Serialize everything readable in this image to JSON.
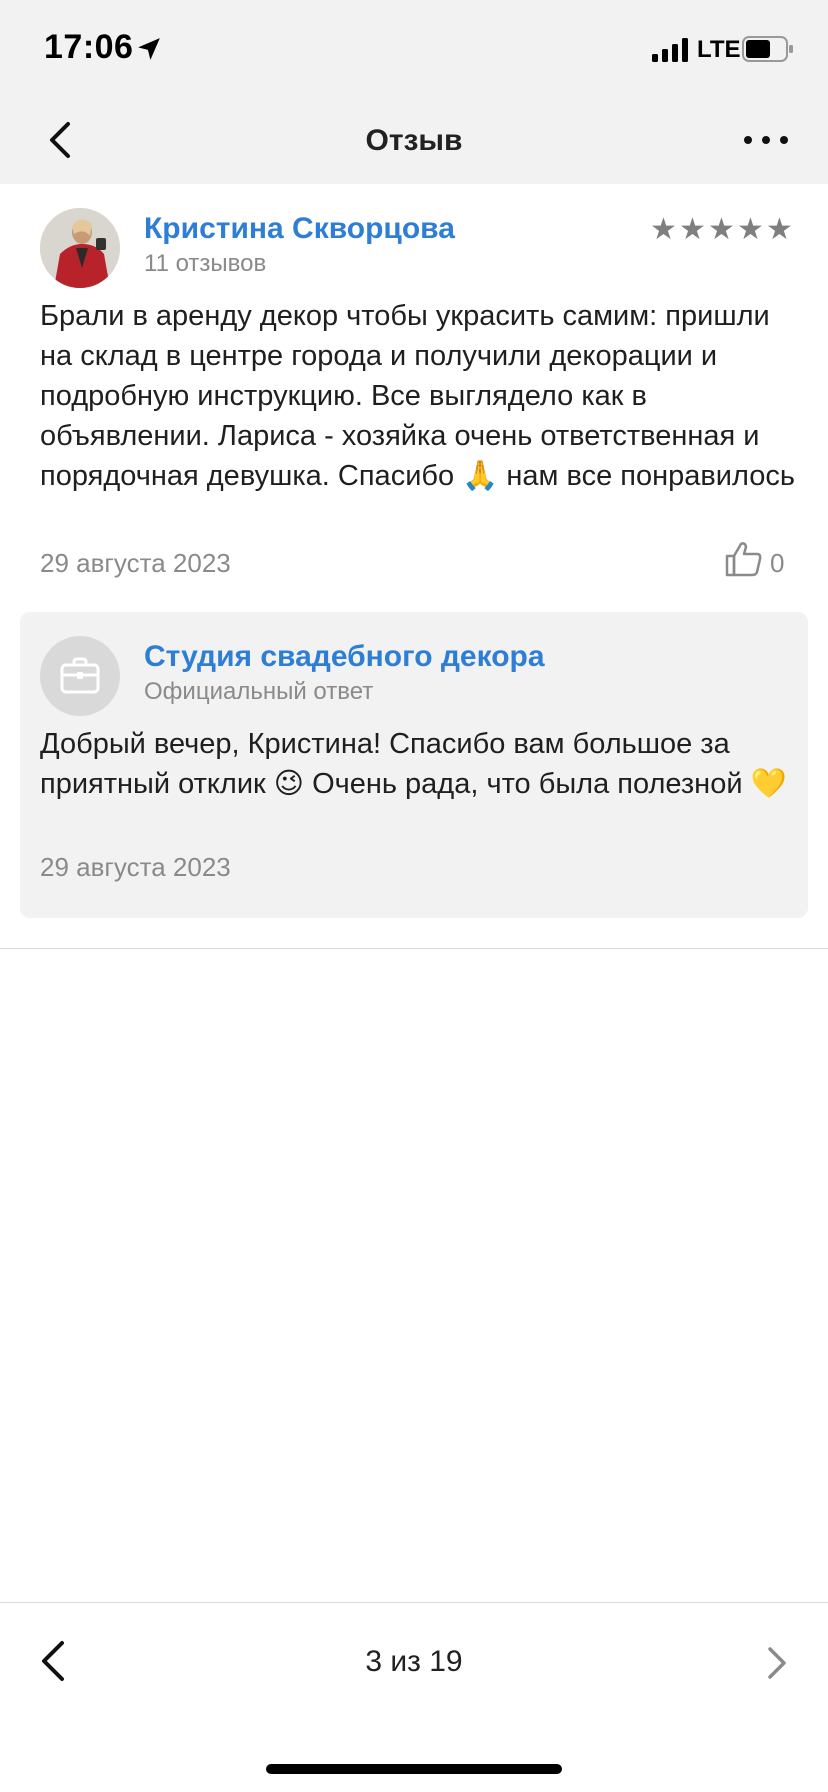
{
  "status_bar": {
    "time": "17:06",
    "network": "LTE"
  },
  "header": {
    "title": "Отзыв"
  },
  "review": {
    "author": "Кристина Скворцова",
    "author_reviews": "11 отзывов",
    "rating": 5,
    "text": "Брали в аренду декор чтобы украсить самим: пришли на склад в центре города и получили декорации и подробную инструкцию. Все выглядело как в объявлении. Лариса - хозяйка очень ответственная и порядочная девушка. Спасибо 🙏 нам все понравилось",
    "date": "29 августа 2023",
    "likes": "0"
  },
  "reply": {
    "author": "Студия свадебного декора",
    "label": "Официальный ответ",
    "text": "Добрый вечер, Кристина! Спасибо вам большое за приятный отклик 😉 Очень рада, что была полезной 💛",
    "date": "29 августа 2023"
  },
  "pager": {
    "indicator": "3 из 19"
  },
  "colors": {
    "link": "#2e7ed6",
    "muted": "#8a8a8a",
    "header_bg": "#f2f2f2"
  }
}
